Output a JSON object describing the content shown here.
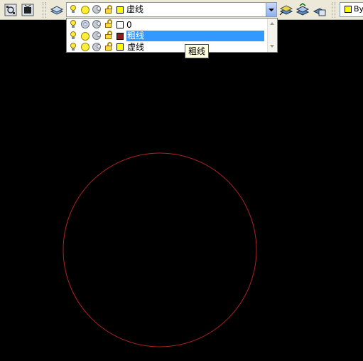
{
  "toolbar": {
    "current_layer": {
      "name": "虚线",
      "color": "#ffff00",
      "on": true,
      "thawed": true,
      "unlocked": true
    },
    "bylayer_label": "By",
    "bylayer_color": "#ffff00"
  },
  "layer_dropdown": {
    "items": [
      {
        "name": "0",
        "color": "#ffffff",
        "frozen_icon": "snowflake-icon",
        "selected": false
      },
      {
        "name": "粗线",
        "color": "#8b1a1a",
        "frozen_icon": "sun-icon",
        "selected": true
      },
      {
        "name": "虚线",
        "color": "#ffff00",
        "frozen_icon": "sun-icon",
        "selected": false
      }
    ]
  },
  "tooltip": {
    "text": "粗线"
  },
  "canvas": {
    "background": "#000000",
    "entity_color": "#b22222",
    "entity_type": "circle"
  },
  "icons": {
    "on": "lightbulb-icon",
    "freeze": "sun-icon",
    "viewport_freeze": "viewport-icon",
    "lock": "unlock-icon"
  }
}
